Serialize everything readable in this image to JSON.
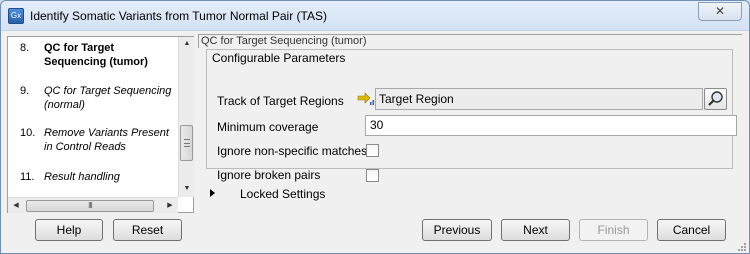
{
  "window": {
    "title": "Identify Somatic Variants from Tumor Normal Pair (TAS)",
    "app_icon_text": "Gx",
    "close_symbol": "✕"
  },
  "steps": [
    {
      "number": "8.",
      "label": "QC for Target Sequencing (tumor)",
      "state": "current"
    },
    {
      "number": "9.",
      "label": "QC for Target Sequencing (normal)",
      "state": "other"
    },
    {
      "number": "10.",
      "label": "Remove Variants Present in Control Reads",
      "state": "other"
    },
    {
      "number": "11.",
      "label": "Result handling",
      "state": "other"
    }
  ],
  "scroll": {
    "grip_glyph": "III",
    "up": "▲",
    "down": "▼",
    "left": "◀",
    "right": "▶"
  },
  "main": {
    "section_header": "QC for Target Sequencing (tumor)",
    "config_title": "Configurable Parameters",
    "params": {
      "track_label": "Track of Target Regions",
      "track_value": "Target Region",
      "min_coverage_label": "Minimum coverage",
      "min_coverage_value": "30",
      "ignore_nonspecific_label": "Ignore non-specific matches",
      "ignore_nonspecific_checked": false,
      "ignore_broken_label": "Ignore broken pairs",
      "ignore_broken_checked": false
    },
    "locked_settings_label": "Locked Settings"
  },
  "buttons": {
    "help": "Help",
    "reset": "Reset",
    "previous": "Previous",
    "next": "Next",
    "finish": "Finish",
    "cancel": "Cancel"
  },
  "colors": {
    "title_bar": "#d9e6f6",
    "track_icon_arrow": "#e0b800",
    "track_icon_bars": "#3a66b0"
  }
}
